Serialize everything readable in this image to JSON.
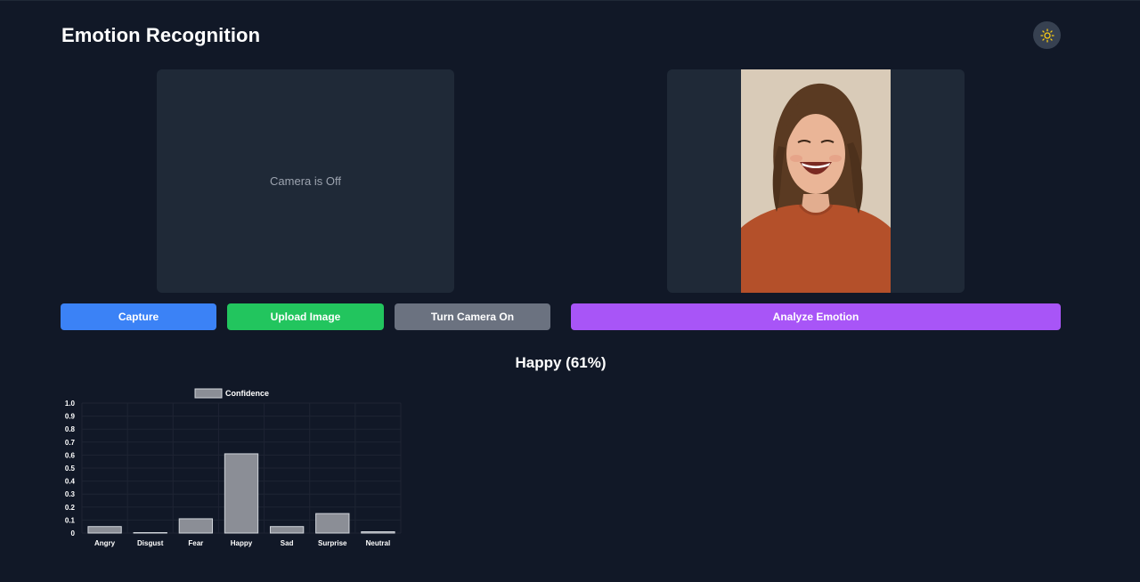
{
  "header": {
    "title": "Emotion Recognition",
    "theme_toggle_icon": "sun-icon"
  },
  "camera_panel": {
    "status_text": "Camera is Off"
  },
  "preview_panel": {
    "image_description": "smiling woman photo"
  },
  "buttons": {
    "capture": "Capture",
    "upload": "Upload Image",
    "toggle_camera": "Turn Camera On",
    "analyze": "Analyze Emotion"
  },
  "result": {
    "text": "Happy (61%)"
  },
  "colors": {
    "background": "#111827",
    "panel": "#1f2937",
    "capture": "#3b82f6",
    "upload": "#22c55e",
    "toggle_camera": "#6b7280",
    "analyze": "#a855f7",
    "bar_fill": "#8b8e96",
    "bar_stroke": "#d1d5db"
  },
  "chart_data": {
    "type": "bar",
    "categories": [
      "Angry",
      "Disgust",
      "Fear",
      "Happy",
      "Sad",
      "Surprise",
      "Neutral"
    ],
    "series": [
      {
        "name": "Confidence",
        "values": [
          0.05,
          0.0,
          0.11,
          0.61,
          0.05,
          0.15,
          0.01
        ]
      }
    ],
    "yticks": [
      "0",
      "0.1",
      "0.2",
      "0.3",
      "0.4",
      "0.5",
      "0.6",
      "0.7",
      "0.8",
      "0.9",
      "1.0"
    ],
    "ylim": [
      0,
      1.0
    ],
    "legend_position": "top",
    "grid": true
  }
}
